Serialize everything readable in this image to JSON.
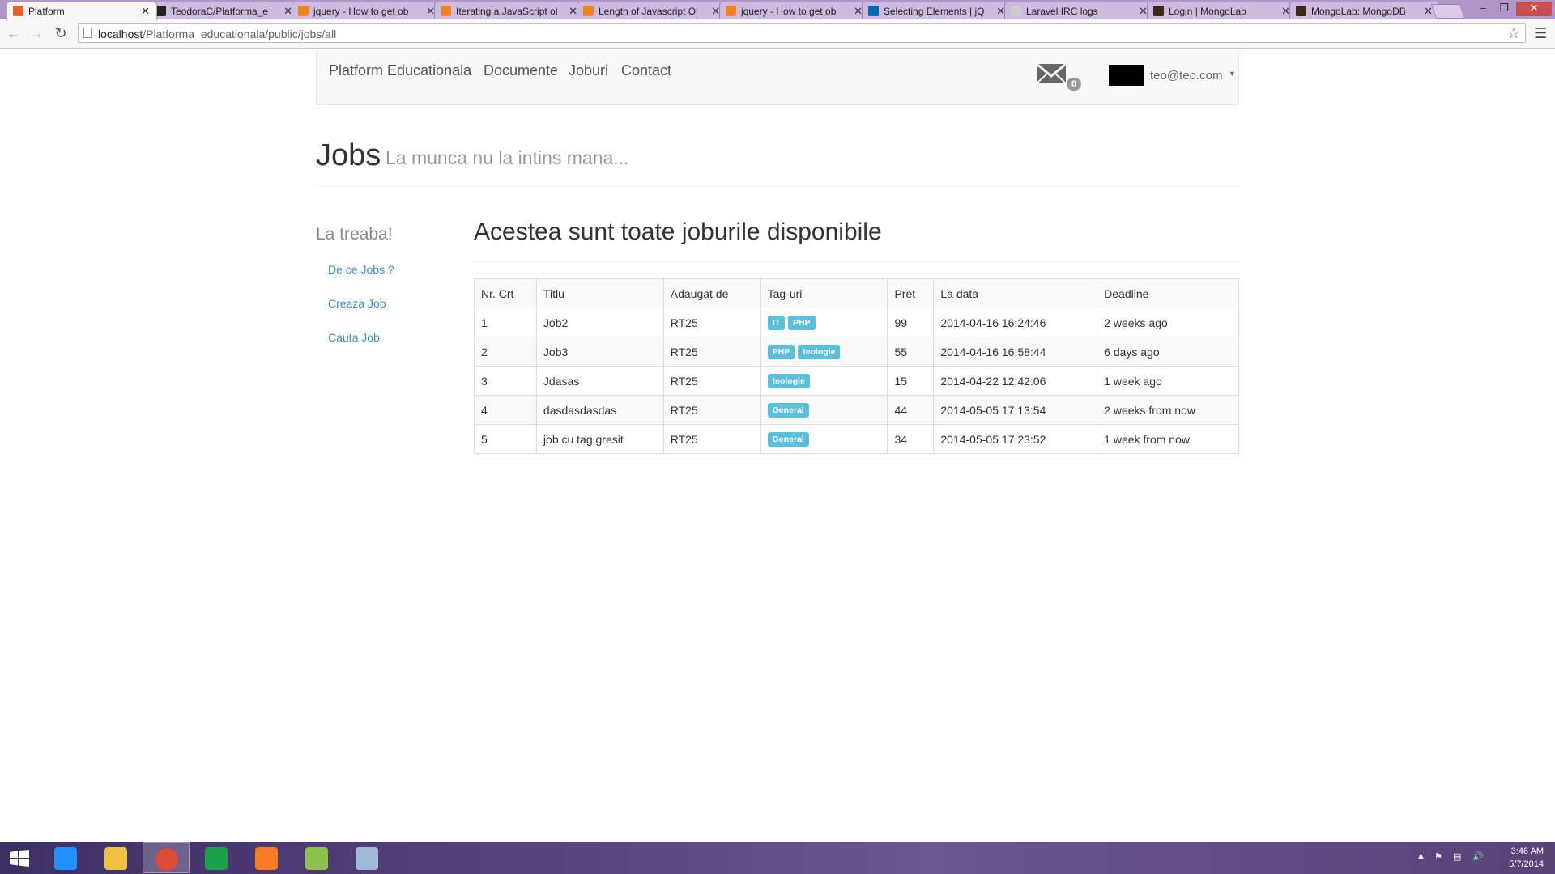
{
  "browser": {
    "tabs": [
      {
        "label": "Platform",
        "active": true,
        "favicon_color": "#e8612c"
      },
      {
        "label": "TeodoraC/Platforma_e",
        "active": false,
        "favicon_color": "#222222"
      },
      {
        "label": "jquery - How to get ob",
        "active": false,
        "favicon_color": "#f48024"
      },
      {
        "label": "Iterating a JavaScript ol",
        "active": false,
        "favicon_color": "#f48024"
      },
      {
        "label": "Length of Javascript Ol",
        "active": false,
        "favicon_color": "#f48024"
      },
      {
        "label": "jquery - How to get ob",
        "active": false,
        "favicon_color": "#f48024"
      },
      {
        "label": "Selecting Elements | jQ",
        "active": false,
        "favicon_color": "#0769ad"
      },
      {
        "label": "Laravel IRC logs",
        "active": false,
        "favicon_color": "#cccccc"
      },
      {
        "label": "Login | MongoLab",
        "active": false,
        "favicon_color": "#3b2a1a"
      },
      {
        "label": "MongoLab: MongoDB",
        "active": false,
        "favicon_color": "#3b2a1a"
      }
    ],
    "url_host": "localhost",
    "url_path": "/Platforma_educationala/public/jobs/all"
  },
  "navbar": {
    "brand": "Platform Educationala",
    "links": [
      "Documente",
      "Joburi",
      "Contact"
    ],
    "mail_count": "0",
    "user_email": "teo@teo.com"
  },
  "header": {
    "title": "Jobs",
    "subtitle": "La munca nu la intins mana..."
  },
  "sidebar": {
    "heading": "La treaba!",
    "links": [
      "De ce Jobs ?",
      "Creaza Job",
      "Cauta Job"
    ]
  },
  "main": {
    "heading": "Acestea sunt toate joburile disponibile",
    "table": {
      "columns": [
        "Nr. Crt",
        "Titlu",
        "Adaugat de",
        "Tag-uri",
        "Pret",
        "La data",
        "Deadline"
      ],
      "rows": [
        {
          "nr": "1",
          "title": "Job2",
          "added_by": "RT25",
          "tags": [
            "IT",
            "PHP"
          ],
          "price": "99",
          "date": "2014-04-16 16:24:46",
          "deadline": "2 weeks ago"
        },
        {
          "nr": "2",
          "title": "Job3",
          "added_by": "RT25",
          "tags": [
            "PHP",
            "teologie"
          ],
          "price": "55",
          "date": "2014-04-16 16:58:44",
          "deadline": "6 days ago"
        },
        {
          "nr": "3",
          "title": "Jdasas",
          "added_by": "RT25",
          "tags": [
            "teologie"
          ],
          "price": "15",
          "date": "2014-04-22 12:42:06",
          "deadline": "1 week ago"
        },
        {
          "nr": "4",
          "title": "dasdasdasdas",
          "added_by": "RT25",
          "tags": [
            "General"
          ],
          "price": "44",
          "date": "2014-05-05 17:13:54",
          "deadline": "2 weeks from now"
        },
        {
          "nr": "5",
          "title": "job cu tag gresit",
          "added_by": "RT25",
          "tags": [
            "General"
          ],
          "price": "34",
          "date": "2014-05-05 17:23:52",
          "deadline": "1 week from now"
        }
      ]
    }
  },
  "taskbar": {
    "apps": [
      {
        "name": "internet-explorer",
        "color": "#1e90ff"
      },
      {
        "name": "file-explorer",
        "color": "#f0c040"
      },
      {
        "name": "chrome",
        "color": "#dd4b39"
      },
      {
        "name": "store",
        "color": "#1aa34a"
      },
      {
        "name": "xampp",
        "color": "#fb7a24"
      },
      {
        "name": "notepad-plus-plus",
        "color": "#8bc34a"
      },
      {
        "name": "paint",
        "color": "#9fb8d8"
      }
    ],
    "time": "3:46 AM",
    "date": "5/7/2014"
  }
}
